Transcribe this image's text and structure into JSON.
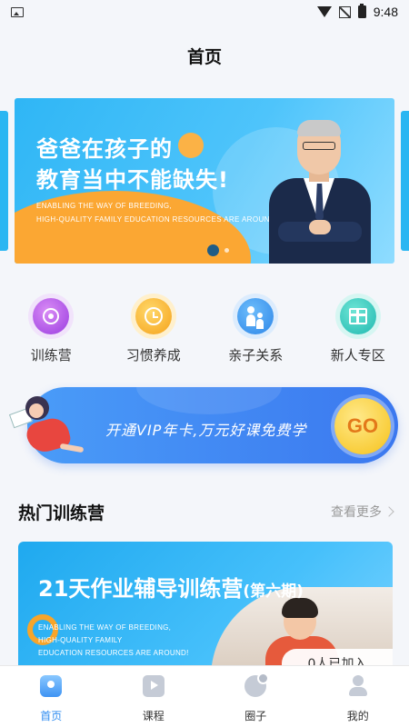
{
  "status_bar": {
    "time": "9:48"
  },
  "header": {
    "title": "首页"
  },
  "banner": {
    "line1": "爸爸在孩子的",
    "line2": "教育当中不能缺失!",
    "en_line1": "ENABLING THE WAY OF BREEDING,",
    "en_line2": "HIGH-QUALITY FAMILY EDUCATION RESOURCES ARE AROUN",
    "active_slide": 1,
    "slide_count": 2
  },
  "categories": [
    {
      "label": "训练营",
      "icon": "target-icon",
      "color": "#9a3ce0"
    },
    {
      "label": "习惯养成",
      "icon": "alarm-clock-icon",
      "color": "#f5a21a"
    },
    {
      "label": "亲子关系",
      "icon": "parent-child-icon",
      "color": "#2d86e8"
    },
    {
      "label": "新人专区",
      "icon": "gift-icon",
      "color": "#1fb8b0"
    }
  ],
  "vip_banner": {
    "text": "开通VIP年卡,万元好课免费学",
    "go_label": "GO"
  },
  "hot_section": {
    "title": "热门训练营",
    "more_label": "查看更多"
  },
  "camp_card": {
    "title": "21天作业辅导训练营",
    "subtitle": "(第六期)",
    "en_line1": "ENABLING THE WAY OF BREEDING,",
    "en_line2": "HIGH-QUALITY FAMILY",
    "en_line3": "EDUCATION RESOURCES ARE AROUND!",
    "joined": "0人已加入"
  },
  "tabbar": {
    "items": [
      {
        "label": "首页",
        "icon": "home-icon",
        "active": true
      },
      {
        "label": "课程",
        "icon": "course-icon",
        "active": false
      },
      {
        "label": "圈子",
        "icon": "circle-icon",
        "active": false
      },
      {
        "label": "我的",
        "icon": "profile-icon",
        "active": false
      }
    ]
  },
  "colors": {
    "accent": "#2f8cf0",
    "banner_blue": "#2fb6f5",
    "banner_orange": "#fba733"
  }
}
